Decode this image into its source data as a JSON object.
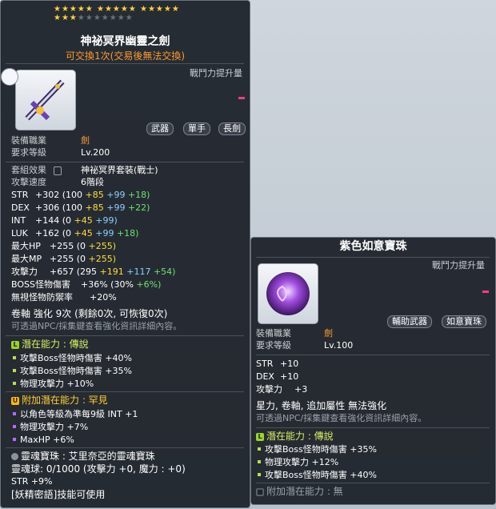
{
  "item1": {
    "stars_row1": "★★★★★ ★★★★★ ★★★★★",
    "stars_row2_on": "★★★",
    "stars_row2_off": "★★★★★★★",
    "name": "神祕冥界幽靈之劍",
    "trade_note": "可交換1次(交易後無法交換)",
    "power_label": "戰鬥力提升量",
    "tags": [
      "武器",
      "單手",
      "長劍"
    ],
    "job_label": "裝備職業",
    "job_value": "劍",
    "level_label": "要求等級",
    "level_value": "Lv.200",
    "set_label": "套組效果",
    "set_value": "神祕冥界套裝(戰士)",
    "speed_label": "攻擊速度",
    "speed_value": "6階段",
    "stats": [
      {
        "name": "STR",
        "main": "+302",
        "base": "(100",
        "p1": "+85",
        "p2": "+99",
        "p3": "+18)"
      },
      {
        "name": "DEX",
        "main": "+306",
        "base": "(100",
        "p1": "+85",
        "p2": "+99",
        "p3": "+22)"
      },
      {
        "name": "INT",
        "main": "+144",
        "base": "(0",
        "p1": "+45",
        "p2": "+99)",
        "p3": ""
      },
      {
        "name": "LUK",
        "main": "+162",
        "base": "(0",
        "p1": "+45",
        "p2": "+99",
        "p3": "+18)"
      }
    ],
    "hp_label": "最大HP",
    "hp_main": "+255",
    "hp_base": "(0",
    "hp_p1": "+255)",
    "mp_label": "最大MP",
    "mp_main": "+255",
    "mp_base": "(0",
    "mp_p1": "+255)",
    "atk_label": "攻擊力",
    "atk_main": "+657",
    "atk_base": "(295",
    "atk_p1": "+191",
    "atk_p2": "+117",
    "atk_p3": "+54)",
    "boss_label": "BOSS怪物傷害",
    "boss_main": "+36%",
    "boss_base": "(30%",
    "boss_p3": "+6%)",
    "ignore_label": "無視怪物防禦率",
    "ignore_value": "+20%",
    "scroll_line": "卷軸 強化 9次 (剩餘0次, 可恢復0次)",
    "npc_line": "可透過NPC/採集鍵查看強化資訊詳細內容。",
    "potential_title": "潛在能力 : 傳說",
    "potential_lines": [
      "攻擊Boss怪物時傷害 +40%",
      "攻擊Boss怪物時傷害 +35%",
      "物理攻擊力 +10%"
    ],
    "add_potential_title": "附加潛在能力 : 罕見",
    "add_potential_lines": [
      "以角色等級為準每9級 INT +1",
      "物理攻擊力 +7%",
      "MaxHP +6%"
    ],
    "soul_title": "靈魂寶珠 : 艾里奈亞的靈魂寶珠",
    "soul_line": "靈魂球:  0/1000 (攻擊力 +0, 魔力 : +0)",
    "soul_str": "STR +9%",
    "soul_skill": "[妖精密語]技能可使用"
  },
  "item2": {
    "name": "紫色如意寶珠",
    "power_label": "戰鬥力提升量",
    "tags": [
      "輔助武器",
      "如意寶珠"
    ],
    "job_label": "裝備職業",
    "job_value": "劍",
    "level_label": "要求等級",
    "level_value": "Lv.100",
    "stats": [
      {
        "name": "STR",
        "value": "+10"
      },
      {
        "name": "DEX",
        "value": "+10"
      },
      {
        "name": "攻擊力",
        "value": "+3"
      }
    ],
    "note_line": "星力, 卷軸, 追加屬性 無法強化",
    "npc_line": "可透過NPC/採集鍵查看強化資訊詳細內容。",
    "potential_title": "潛在能力 : 傳說",
    "potential_lines": [
      "攻擊Boss怪物時傷害 +35%",
      "物理攻擊力 +12%",
      "攻擊Boss怪物時傷害 +40%"
    ],
    "add_potential_title": "附加潛在能力 : 無"
  },
  "colors": {
    "legend": "#d7f05f",
    "unique": "#ffcc33",
    "accent_orange": "#ff9f33"
  }
}
